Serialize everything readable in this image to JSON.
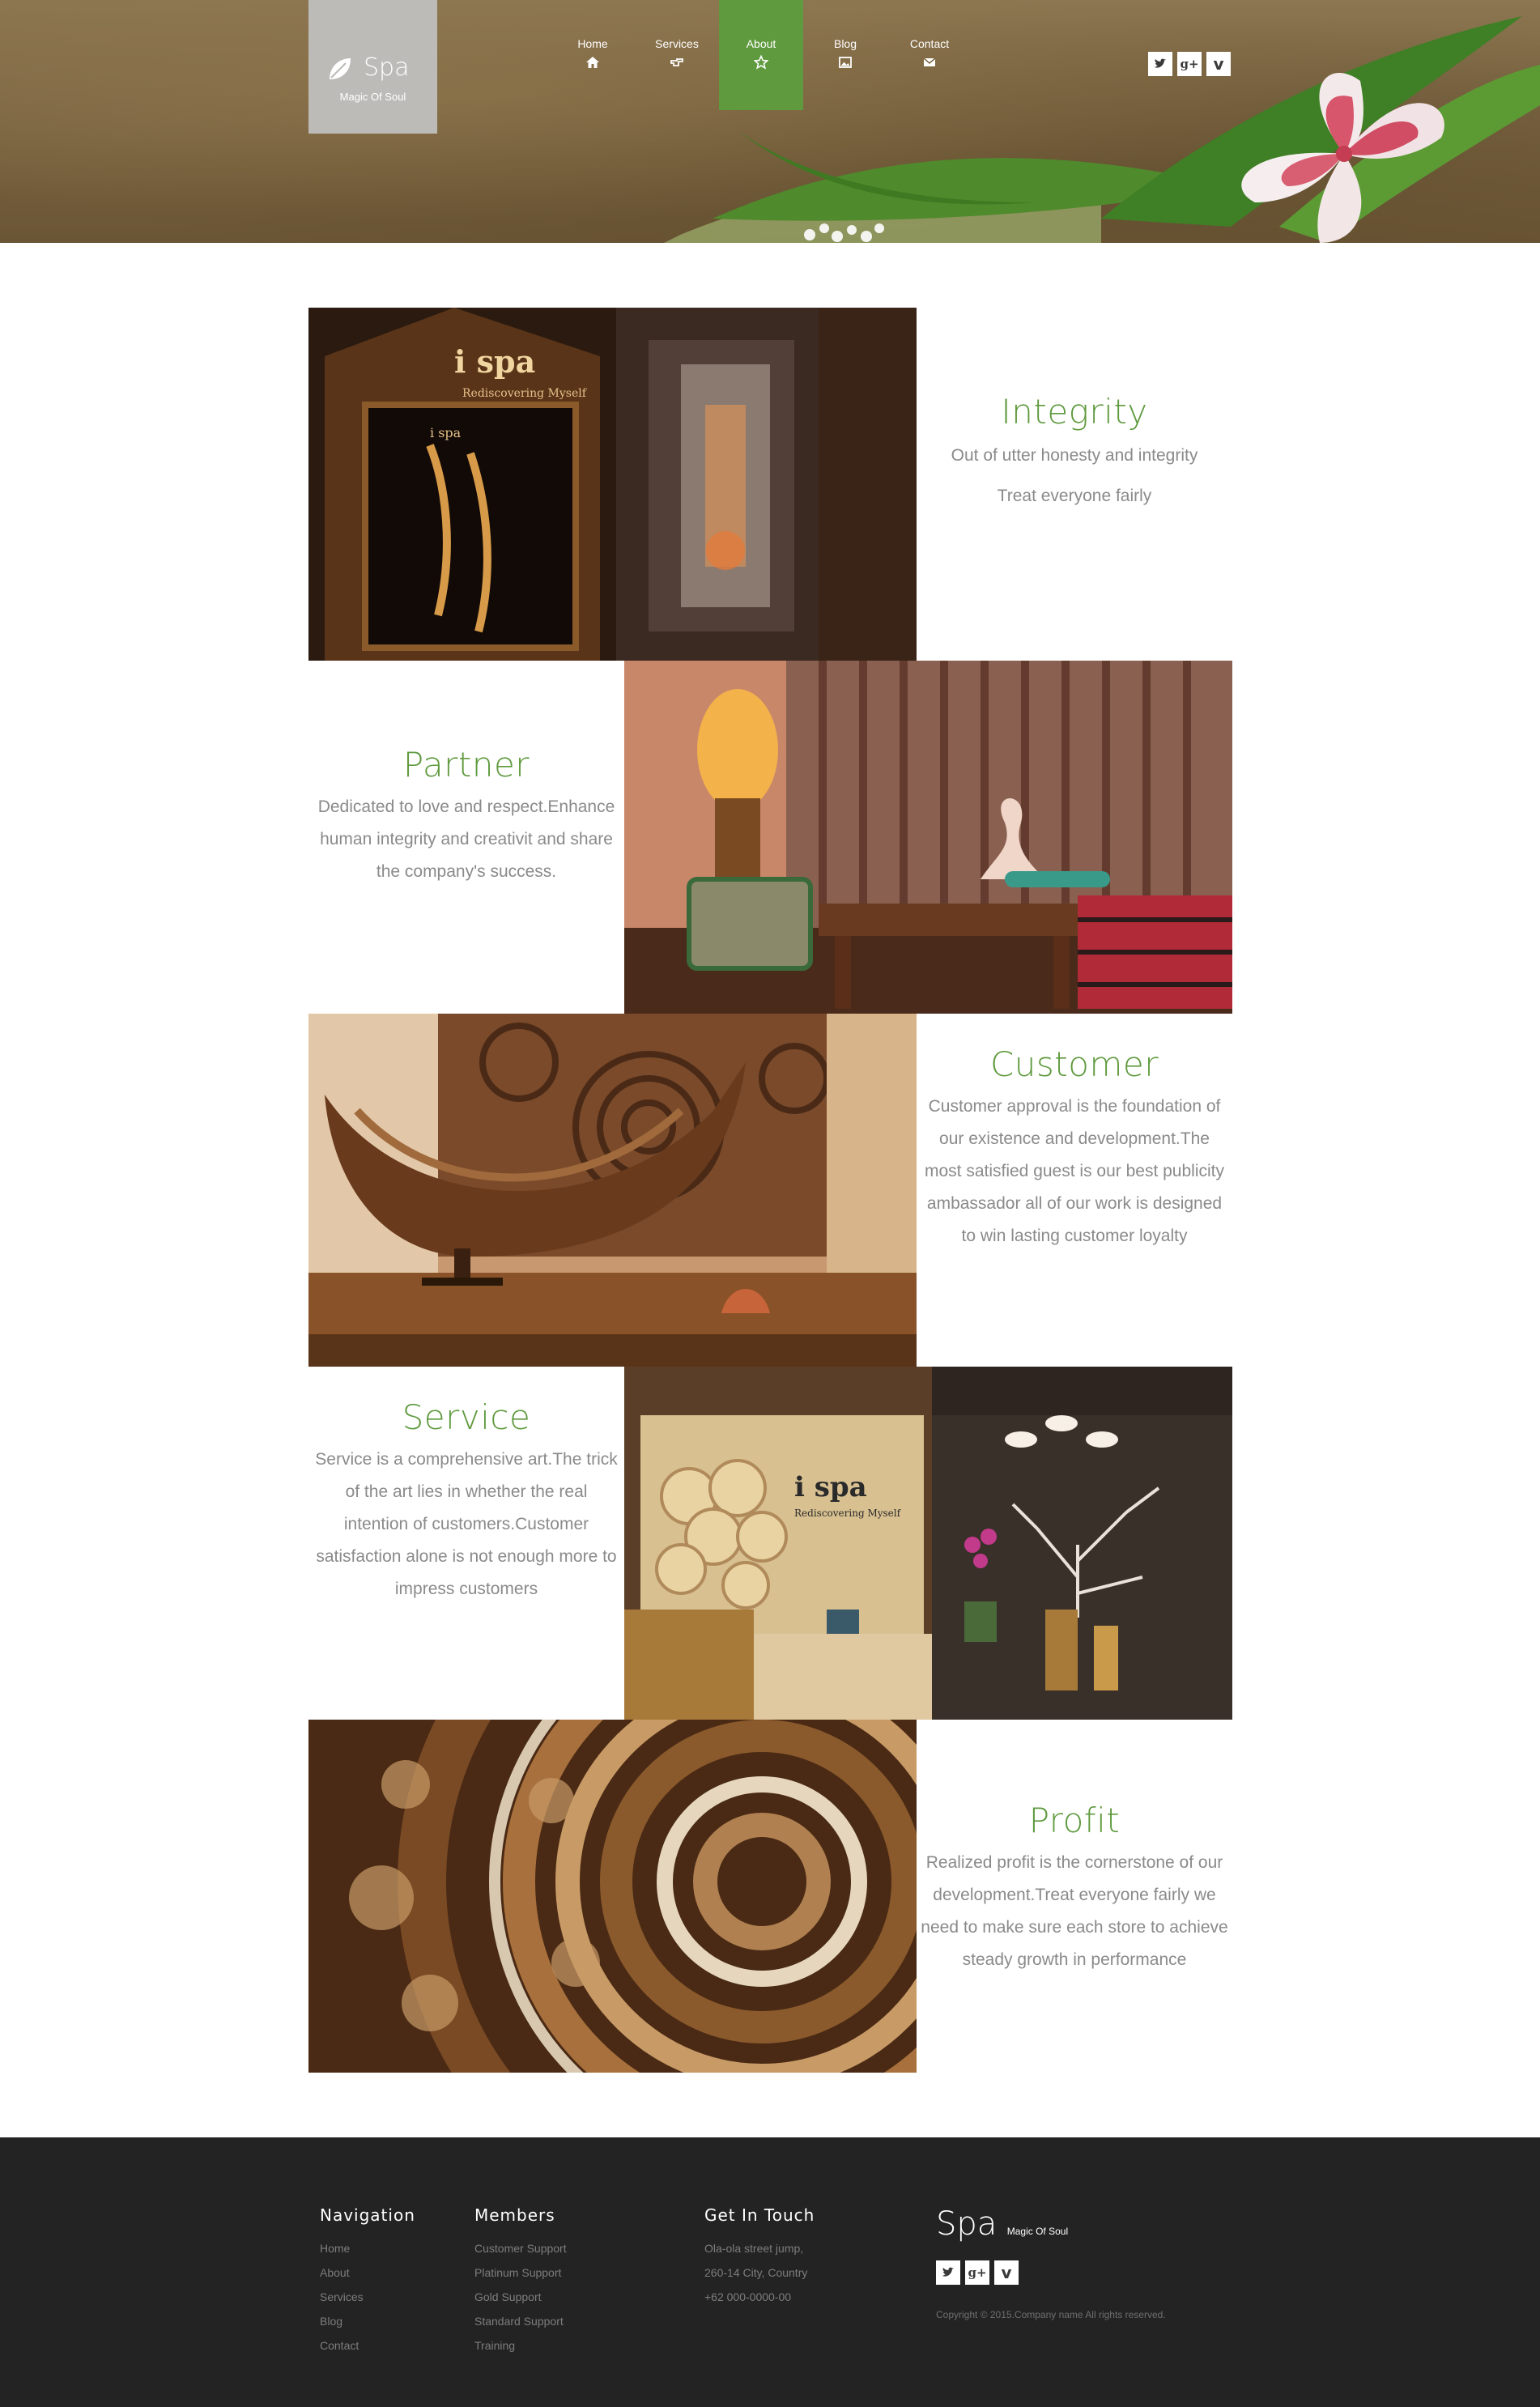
{
  "brand": {
    "name": "Spa",
    "tagline": "Magic Of Soul"
  },
  "nav": [
    {
      "label": "Home",
      "icon": "home-icon"
    },
    {
      "label": "Services",
      "icon": "pointing-hand-icon"
    },
    {
      "label": "About",
      "icon": "star-icon",
      "active": true
    },
    {
      "label": "Blog",
      "icon": "picture-icon"
    },
    {
      "label": "Contact",
      "icon": "envelope-icon"
    }
  ],
  "social": [
    {
      "icon": "twitter-icon",
      "glyph": "t"
    },
    {
      "icon": "google-plus-icon",
      "glyph": "g+"
    },
    {
      "icon": "vimeo-icon",
      "glyph": "v"
    }
  ],
  "sections": [
    {
      "title": "Integrity",
      "lines": [
        "Out of utter honesty and integrity",
        "Treat everyone fairly"
      ]
    },
    {
      "title": "Partner",
      "text": "Dedicated to love and respect.Enhance human integrity and creativit and share the company's success."
    },
    {
      "title": "Customer",
      "text": "Customer approval is the foundation of our existence and development.The most satisfied guest is our best publicity ambassador all of our work is designed to win lasting customer loyalty"
    },
    {
      "title": "Service",
      "text": "Service is a comprehensive art.The trick of the art lies in whether the real intention of customers.Customer satisfaction alone is not enough more to impress customers"
    },
    {
      "title": "Profit",
      "text": "Realized profit is the cornerstone of our development.Treat everyone fairly we need to make sure each store to achieve steady growth in performance"
    }
  ],
  "images": {
    "sign_logo": "i spa",
    "sign_sub": "Rediscovering Myself",
    "sign_small": "i spa"
  },
  "footer": {
    "navigation": {
      "title": "Navigation",
      "items": [
        "Home",
        "About",
        "Services",
        "Blog",
        "Contact"
      ]
    },
    "members": {
      "title": "Members",
      "items": [
        "Customer Support",
        "Platinum Support",
        "Gold Support",
        "Standard Support",
        "Training"
      ]
    },
    "contact": {
      "title": "Get In Touch",
      "items": [
        "Ola-ola street jump,",
        "260-14 City, Country",
        "+62 000-0000-00"
      ]
    },
    "brand_name": "Spa",
    "brand_tag": "Magic Of Soul",
    "copyright": "Copyright © 2015.Company name All rights reserved."
  },
  "colors": {
    "accent": "#5f9a3e",
    "footer_bg": "#232323",
    "text": "#8a8a8a"
  }
}
